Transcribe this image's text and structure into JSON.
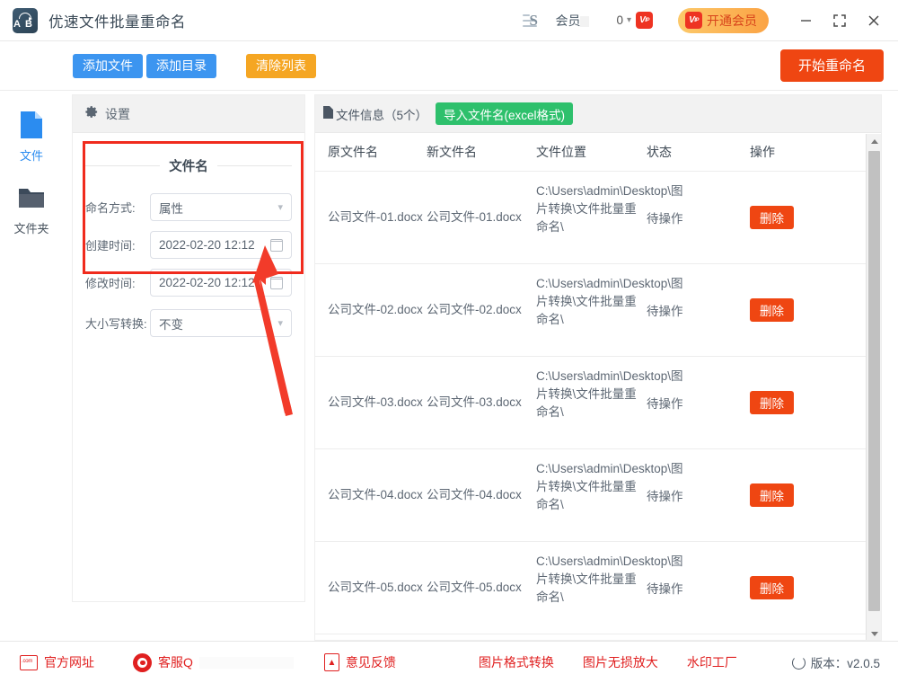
{
  "titlebar": {
    "app_title": "优速文件批量重命名",
    "logo_text": "AB",
    "member_label": "会员",
    "coin_count": "0",
    "vip_badge": "VIP",
    "open_vip_label": "开通会员",
    "minimize_icon": "minimize-icon",
    "maximize_icon": "maximize-icon",
    "close_icon": "close-icon"
  },
  "toolbar": {
    "add_file": "添加文件",
    "add_dir": "添加目录",
    "clear_list": "清除列表",
    "start_rename": "开始重命名"
  },
  "sidebar": {
    "items": [
      {
        "label": "文件",
        "icon": "file-icon",
        "active": true
      },
      {
        "label": "文件夹",
        "icon": "folder-icon",
        "active": false
      }
    ]
  },
  "settings": {
    "header": "设置",
    "header_icon": "gear-icon",
    "section_title": "文件名",
    "fields": [
      {
        "label": "命名方式:",
        "value": "属性",
        "control": "select"
      },
      {
        "label": "创建时间:",
        "value": "2022-02-20 12:12",
        "control": "datetime"
      },
      {
        "label": "修改时间:",
        "value": "2022-02-20 12:12",
        "control": "datetime"
      },
      {
        "label": "大小写转换:",
        "value": "不变",
        "control": "select"
      }
    ]
  },
  "filepanel": {
    "title": "文件信息（5个）",
    "title_icon": "file-icon",
    "import_button": "导入文件名(excel格式)",
    "columns": [
      "原文件名",
      "新文件名",
      "文件位置",
      "状态",
      "操作"
    ],
    "rows": [
      {
        "old_name": "公司文件-01.docx",
        "new_name": "公司文件-01.docx",
        "path": "C:\\Users\\admin\\Desktop\\图片转换\\文件批量重命名\\",
        "status": "待操作",
        "action": "删除"
      },
      {
        "old_name": "公司文件-02.docx",
        "new_name": "公司文件-02.docx",
        "path": "C:\\Users\\admin\\Desktop\\图片转换\\文件批量重命名\\",
        "status": "待操作",
        "action": "删除"
      },
      {
        "old_name": "公司文件-03.docx",
        "new_name": "公司文件-03.docx",
        "path": "C:\\Users\\admin\\Desktop\\图片转换\\文件批量重命名\\",
        "status": "待操作",
        "action": "删除"
      },
      {
        "old_name": "公司文件-04.docx",
        "new_name": "公司文件-04.docx",
        "path": "C:\\Users\\admin\\Desktop\\图片转换\\文件批量重命名\\",
        "status": "待操作",
        "action": "删除"
      },
      {
        "old_name": "公司文件-05.docx",
        "new_name": "公司文件-05.docx",
        "path": "C:\\Users\\admin\\Desktop\\图片转换\\文件批量重命名\\",
        "status": "待操作",
        "action": "删除"
      }
    ]
  },
  "footer": {
    "website": "官方网址",
    "website_icon": "dotcom-icon",
    "support": "客服Q",
    "support_icon": "headset-icon",
    "feedback": "意见反馈",
    "feedback_icon": "pdf-icon",
    "links": [
      "图片格式转换",
      "图片无损放大",
      "水印工厂"
    ],
    "version": "版本：v2.0.5",
    "version_icon": "refresh-icon"
  },
  "annotation": {
    "box_color": "#f02b1d",
    "arrow_color": "#f23b2a"
  }
}
